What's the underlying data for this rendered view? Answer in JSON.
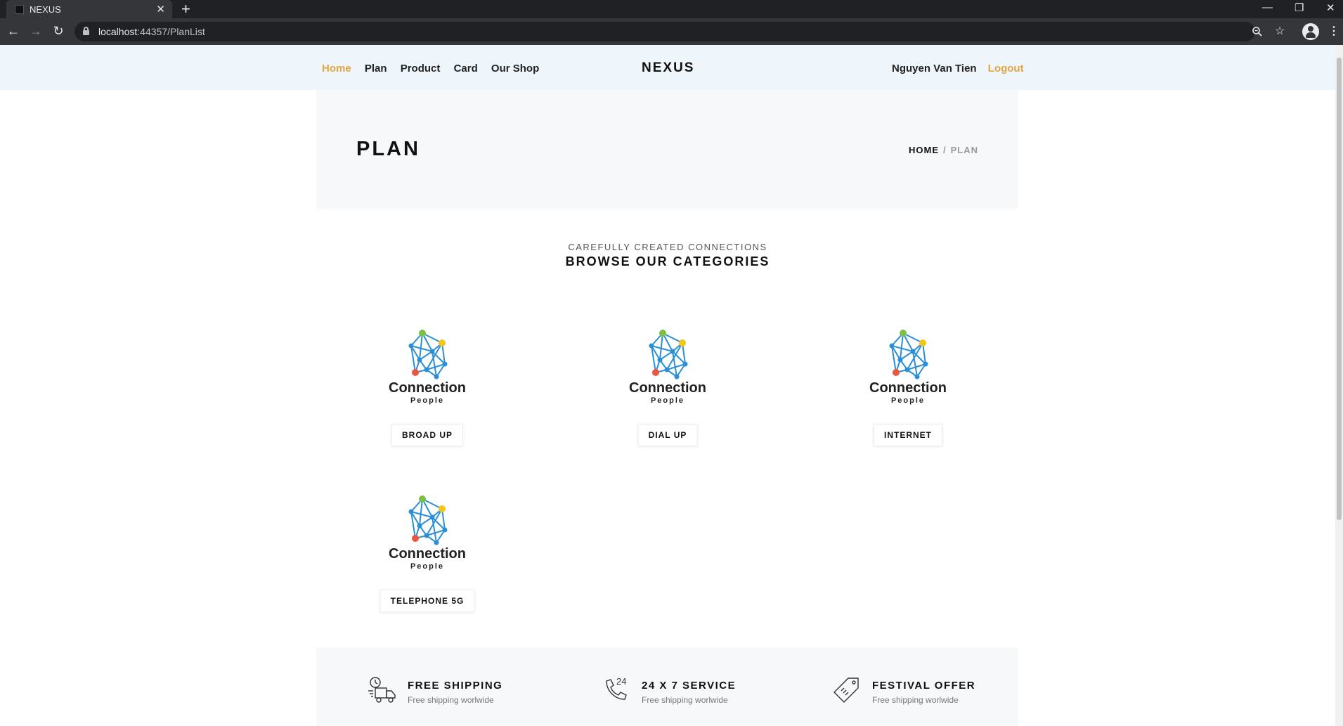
{
  "browser": {
    "tab_title": "NEXUS",
    "tab_close": "✕",
    "new_tab": "+",
    "url_host": "localhost",
    "url_rest": ":44357/PlanList",
    "window_min": "—",
    "window_restore": "❐",
    "window_close": "✕"
  },
  "header": {
    "nav": [
      "Home",
      "Plan",
      "Product",
      "Card",
      "Our Shop"
    ],
    "active_nav": "Home",
    "brand": "NEXUS",
    "username": "Nguyen Van Tien",
    "logout": "Logout"
  },
  "banner": {
    "title": "PLAN",
    "breadcrumb_home": "HOME",
    "breadcrumb_sep": "/",
    "breadcrumb_current": "PLAN"
  },
  "categories": {
    "subtitle": "CAREFULLY CREATED CONNECTIONS",
    "title": "BROWSE OUR CATEGORIES",
    "items": [
      {
        "label": "BROAD UP",
        "logo_word": "Connection",
        "logo_sub": "People"
      },
      {
        "label": "DIAL UP",
        "logo_word": "Connection",
        "logo_sub": "People"
      },
      {
        "label": "INTERNET",
        "logo_word": "Connection",
        "logo_sub": "People"
      },
      {
        "label": "TELEPHONE 5G",
        "logo_word": "Connection",
        "logo_sub": "People"
      }
    ]
  },
  "features": [
    {
      "title": "FREE SHIPPING",
      "subtitle": "Free shipping worlwide",
      "icon": "delivery-truck-icon"
    },
    {
      "title": "24 X 7 SERVICE",
      "subtitle": "Free shipping worlwide",
      "icon": "phone-24-icon"
    },
    {
      "title": "FESTIVAL OFFER",
      "subtitle": "Free shipping worlwide",
      "icon": "price-tag-icon"
    }
  ],
  "colors": {
    "accent": "#e0a544",
    "header_bg": "#eef6fc",
    "banner_bg": "#f7f8f9",
    "logo_blue": "#2a8fd6",
    "logo_green": "#7bc043",
    "logo_yellow": "#f5c518",
    "logo_red": "#e9573f"
  }
}
